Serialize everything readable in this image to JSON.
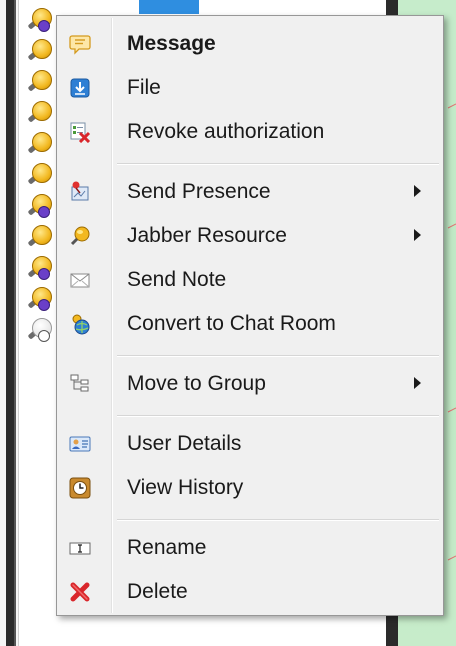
{
  "menu": {
    "items": [
      {
        "label": "Message",
        "icon": "message-icon",
        "bold": true
      },
      {
        "label": "File",
        "icon": "file-download-icon"
      },
      {
        "label": "Revoke authorization",
        "icon": "revoke-icon"
      },
      {
        "label": "Send Presence",
        "icon": "send-presence-icon",
        "submenu": true
      },
      {
        "label": "Jabber Resource",
        "icon": "jabber-resource-icon",
        "submenu": true
      },
      {
        "label": "Send Note",
        "icon": "envelope-icon"
      },
      {
        "label": "Convert to Chat Room",
        "icon": "chat-room-icon"
      },
      {
        "label": "Move to Group",
        "icon": "group-tree-icon",
        "submenu": true
      },
      {
        "label": "User Details",
        "icon": "contact-card-icon"
      },
      {
        "label": "View History",
        "icon": "history-clock-icon"
      },
      {
        "label": "Rename",
        "icon": "rename-icon"
      },
      {
        "label": "Delete",
        "icon": "delete-icon"
      }
    ]
  },
  "colors": {
    "menu_bg": "#f0f0f0",
    "text": "#1a1a1a",
    "contact_bulb": "#f2b820",
    "status_purple": "#6a3fc8",
    "side_panel_green": "#c6eccb",
    "delete_red": "#d9262b"
  }
}
